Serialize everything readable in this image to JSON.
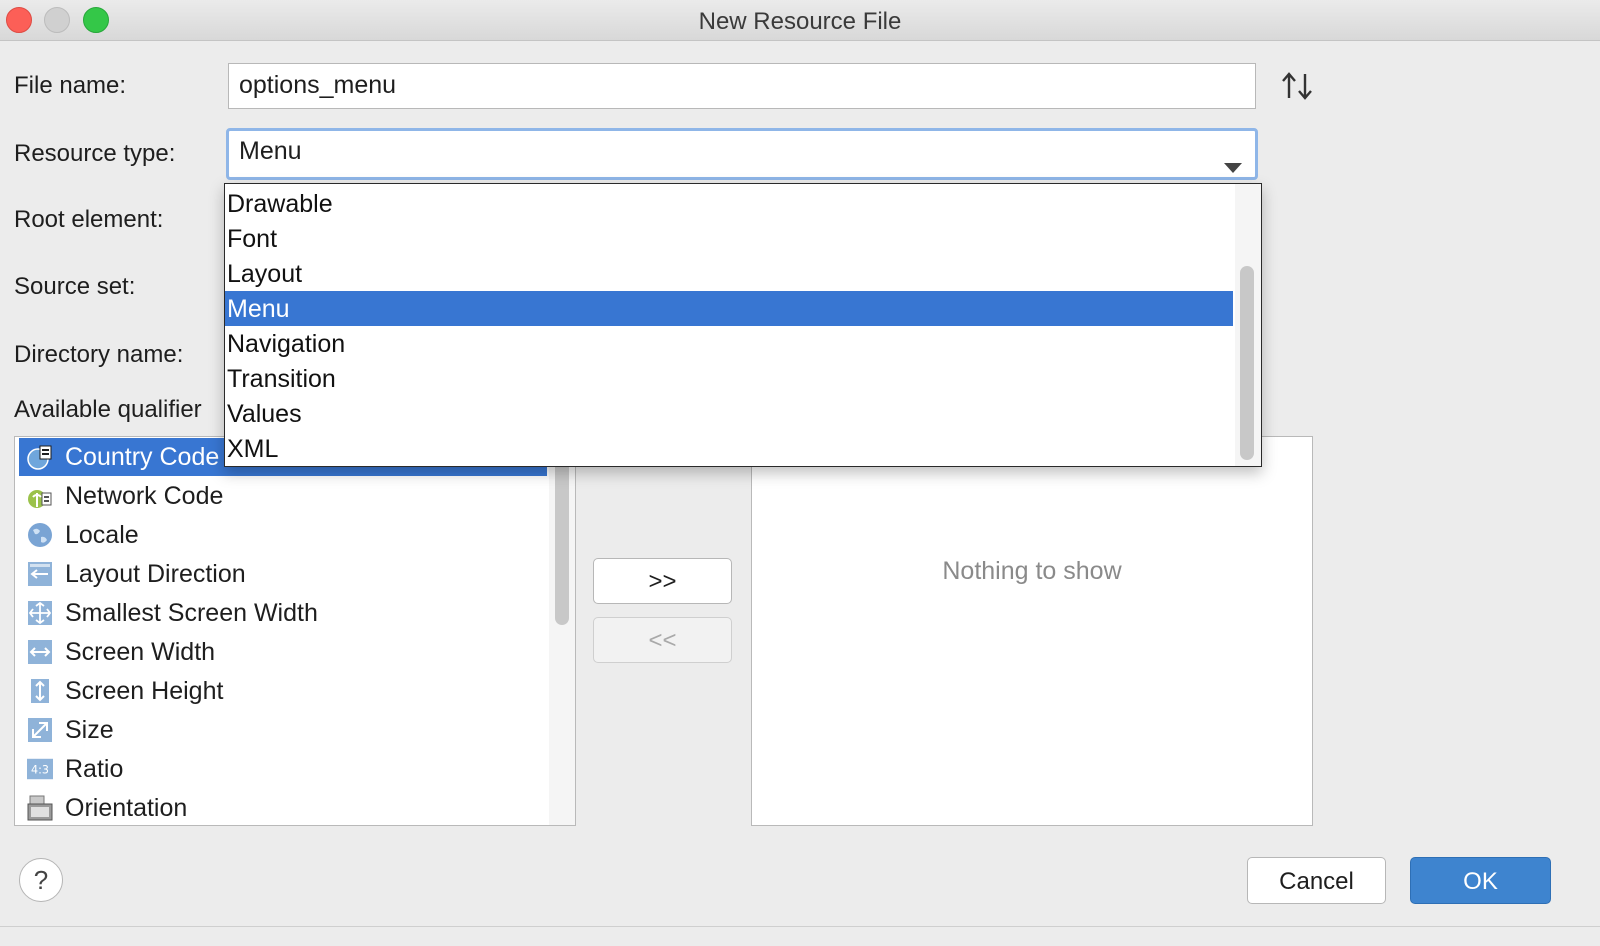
{
  "window": {
    "title": "New Resource File"
  },
  "form": {
    "file_name_label": "File name:",
    "file_name_value": "options_menu",
    "resource_type_label": "Resource type:",
    "resource_type_value": "Menu",
    "root_element_label": "Root element:",
    "source_set_label": "Source set:",
    "directory_name_label": "Directory name:",
    "available_qualifiers_label": "Available qualifier"
  },
  "dropdown": {
    "options": [
      "Drawable",
      "Font",
      "Layout",
      "Menu",
      "Navigation",
      "Transition",
      "Values",
      "XML"
    ],
    "selected": "Menu"
  },
  "qualifiers": {
    "available": [
      {
        "label": "Country Code",
        "icon": "country-code-icon"
      },
      {
        "label": "Network Code",
        "icon": "network-code-icon"
      },
      {
        "label": "Locale",
        "icon": "globe-icon"
      },
      {
        "label": "Layout Direction",
        "icon": "layout-direction-icon"
      },
      {
        "label": "Smallest Screen Width",
        "icon": "smallest-width-icon"
      },
      {
        "label": "Screen Width",
        "icon": "screen-width-icon"
      },
      {
        "label": "Screen Height",
        "icon": "screen-height-icon"
      },
      {
        "label": "Size",
        "icon": "size-icon"
      },
      {
        "label": "Ratio",
        "icon": "ratio-icon"
      },
      {
        "label": "Orientation",
        "icon": "orientation-icon"
      }
    ],
    "chosen_empty_text": "Nothing to show"
  },
  "buttons": {
    "add": ">>",
    "remove": "<<",
    "help": "?",
    "cancel": "Cancel",
    "ok": "OK"
  },
  "icons": {
    "ratio_text": "4:3"
  },
  "colors": {
    "selection": "#3876d2",
    "ok_button": "#3e84cf",
    "focus_ring": "#8fb6e8"
  }
}
